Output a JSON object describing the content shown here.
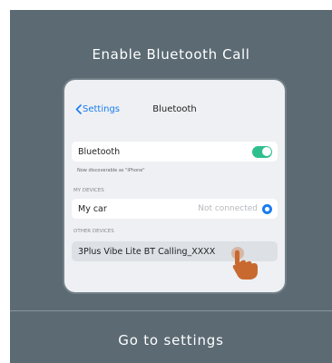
{
  "dialog": {
    "title": "Enable Bluetooth Call",
    "action_label": "Go to settings"
  },
  "phone": {
    "back_label": "Settings",
    "nav_title": "Bluetooth",
    "bluetooth_row_label": "Bluetooth",
    "bluetooth_enabled": true,
    "discoverable_text": "Now discoverable as \"iPhone\"",
    "my_devices_header": "MY DEVICES",
    "my_device_name": "My car",
    "my_device_status": "Not connected",
    "other_devices_header": "OTHER DEVICES",
    "other_device_name": "3Plus Vibe Lite BT Calling_XXXX"
  },
  "colors": {
    "dialog_bg": "#5b6a73",
    "accent_blue": "#1a7cf0",
    "toggle_green": "#2fbf8f",
    "hand_orange": "#c8692f"
  }
}
